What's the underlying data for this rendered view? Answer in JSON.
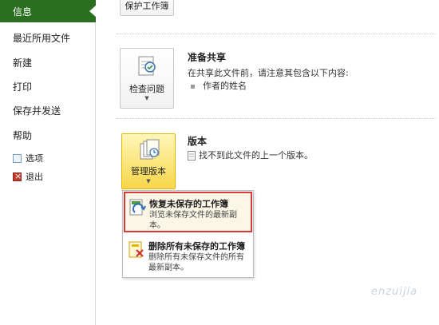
{
  "sidebar": {
    "active": "信息",
    "items": [
      "最近所用文件",
      "新建",
      "打印",
      "保存并发送",
      "帮助"
    ],
    "options_label": "选项",
    "exit_label": "退出"
  },
  "protect": {
    "label": "保护工作簿"
  },
  "prepare": {
    "button_label": "检查问题",
    "title": "准备共享",
    "text": "在共享此文件前，请注意其包含以下内容:",
    "bullet": "作者的姓名"
  },
  "versions": {
    "button_label": "管理版本",
    "title": "版本",
    "text": "找不到此文件的上一个版本。"
  },
  "menu": {
    "recover_title": "恢复未保存的工作簿",
    "recover_desc": "浏览未保存文件的最新副本。",
    "delete_title": "删除所有未保存的工作簿",
    "delete_desc": "删除所有未保存文件的所有最新副本。"
  },
  "watermark": "enzuijia",
  "colors": {
    "accent_green": "#2a6e1f",
    "highlight_red": "#d9383a",
    "button_yellow": "#f7d64a"
  }
}
